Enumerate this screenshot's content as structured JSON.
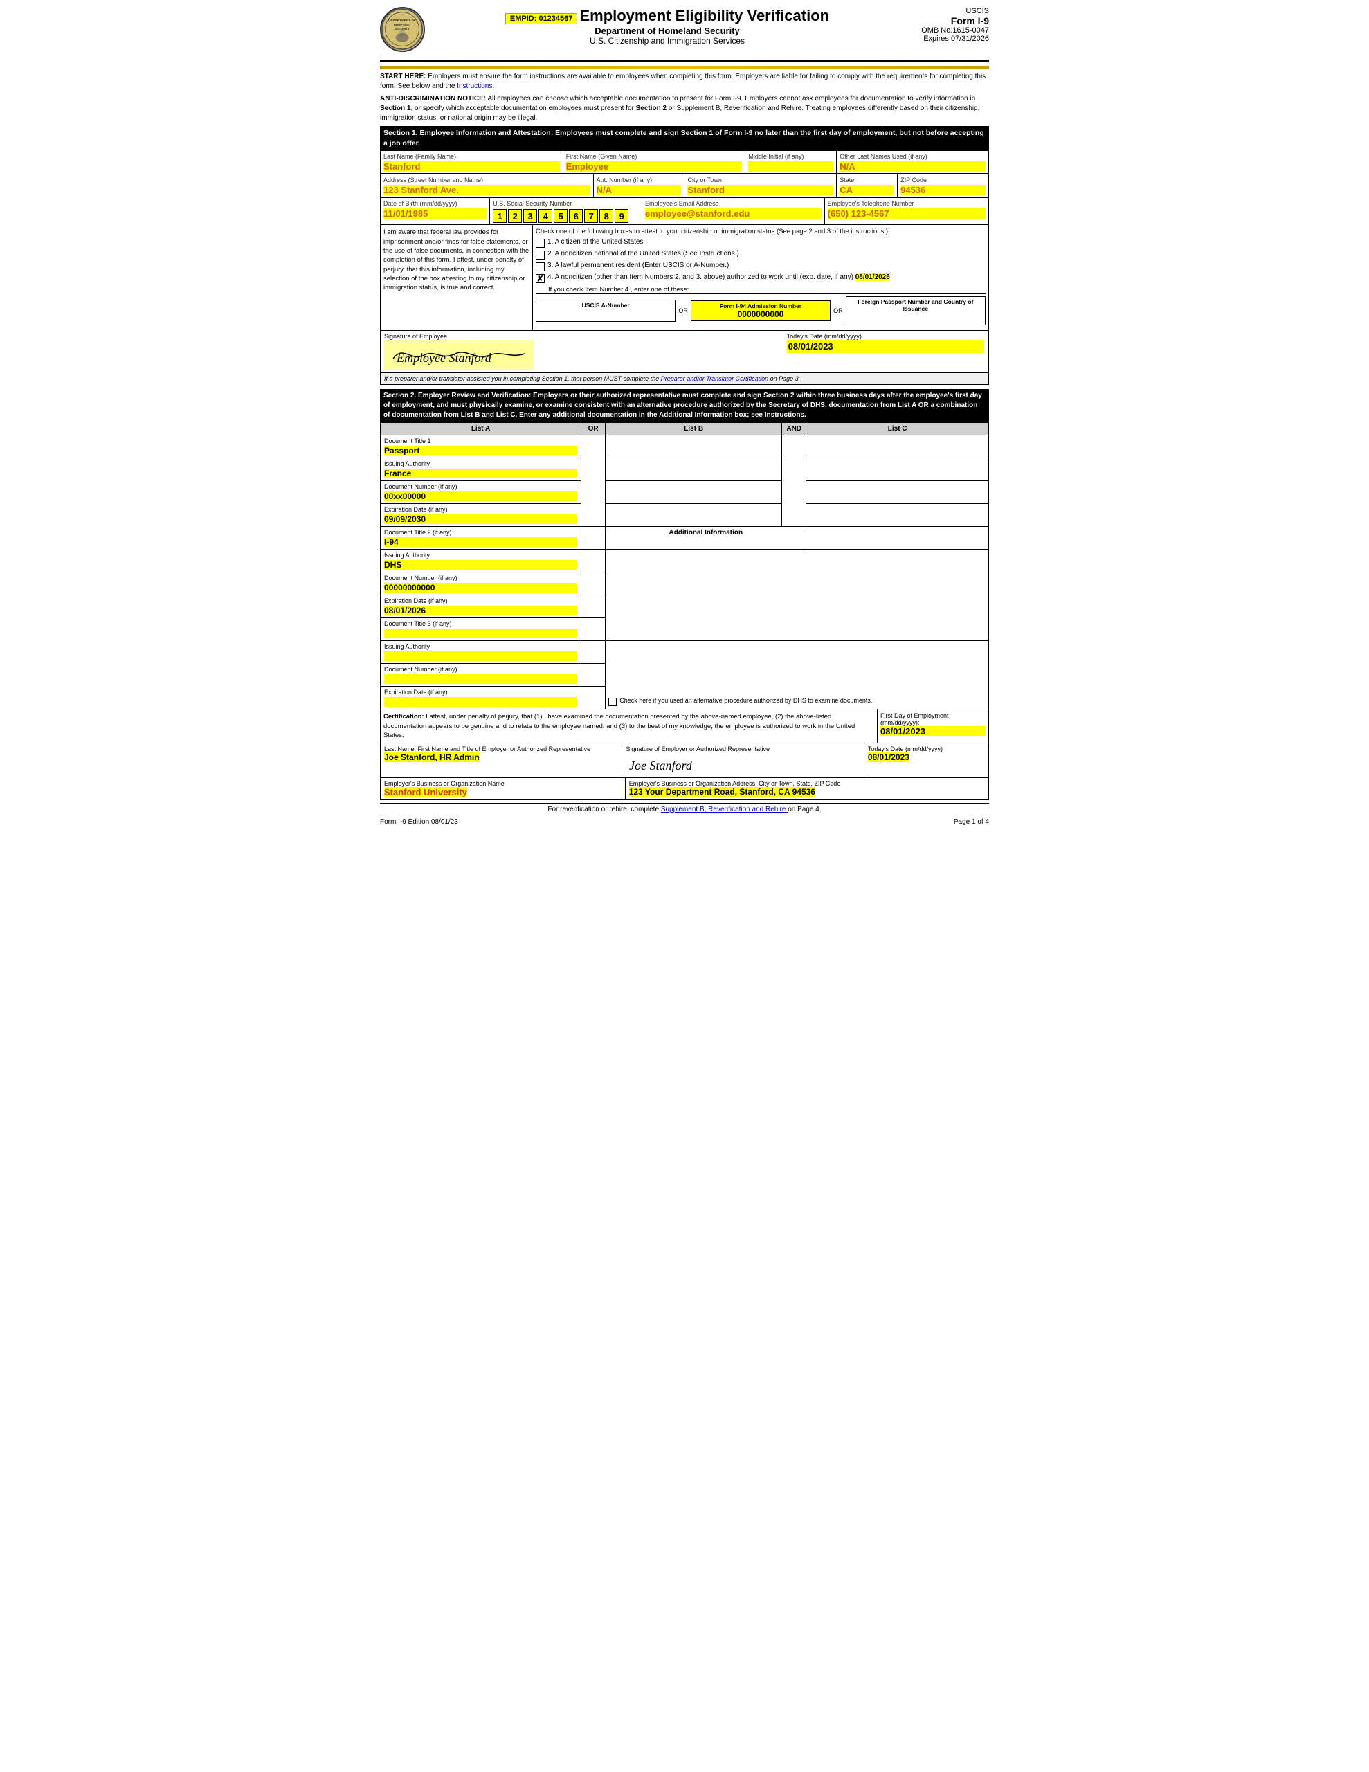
{
  "header": {
    "empid_label": "EMPID: 01234567",
    "form_title": "Employment Eligibility Verification",
    "dept": "Department of Homeland Security",
    "agency": "U.S. Citizenship and Immigration Services",
    "form_id": "USCIS",
    "form_name": "Form I-9",
    "omb": "OMB No.1615-0047",
    "expires": "Expires 07/31/2026"
  },
  "notices": {
    "start_here": "START HERE:  Employers must ensure the form instructions are available to employees when completing this form. Employers are liable for failing to comply with the requirements for completing this form. See below and the Instructions.",
    "anti_disc": "ANTI-DISCRIMINATION NOTICE:  All employees can choose which acceptable documentation to present for Form I-9. Employers cannot ask employees for documentation to verify information in Section 1, or specify which acceptable documentation employees must present for Section 2 or Supplement B, Reverification and Rehire.  Treating employees differently based on their citizenship, immigration status, or national origin may be illegal."
  },
  "section1": {
    "header": "Section 1. Employee Information and Attestation: Employees must complete and sign Section 1 of Form I-9 no later than the first day of employment, but not before accepting a job offer.",
    "last_name_label": "Last Name (Family Name)",
    "last_name": "Stanford",
    "first_name_label": "First Name (Given Name)",
    "first_name": "Employee",
    "middle_initial_label": "Middle Initial (if any)",
    "middle_initial": "",
    "other_names_label": "Other Last Names Used (if any)",
    "other_names": "N/A",
    "address_label": "Address (Street Number and Name)",
    "address": "123 Stanford Ave.",
    "apt_label": "Apt. Number (if any)",
    "apt": "N/A",
    "city_label": "City or Town",
    "city": "Stanford",
    "state_label": "State",
    "state": "CA",
    "zip_label": "ZIP Code",
    "zip": "94536",
    "dob_label": "Date of Birth (mm/dd/yyyy)",
    "dob": "11/01/1985",
    "ssn_label": "U.S. Social Security Number",
    "ssn_digits": [
      "1",
      "2",
      "3",
      "4",
      "5",
      "6",
      "7",
      "8",
      "9"
    ],
    "email_label": "Employee's Email Address",
    "email": "employee@stanford.edu",
    "phone_label": "Employee's Telephone Number",
    "phone": "(650) 123-4567",
    "attestation_left": "I am aware that federal law provides for imprisonment and/or fines for false statements, or the use of false documents, in connection with the completion of this form. I attest, under penalty of perjury, that this information, including my selection of the box attesting to my citizenship or immigration status, is true and correct.",
    "checkbox1": "1.  A citizen of the United States",
    "checkbox2": "2.  A noncitizen national of the United States (See Instructions.)",
    "checkbox3": "3.  A lawful permanent resident (Enter USCIS or A-Number.)",
    "checkbox4": "4.  A noncitizen (other than Item Numbers 2. and 3. above) authorized to work until (exp. date, if any)",
    "work_until": "08/01/2026",
    "if_check4": "If you check Item Number 4., enter one of these:",
    "uscis_label": "USCIS A-Number",
    "or1": "OR",
    "form94_label": "Form I-94 Admission Number",
    "form94_value": "0000000000",
    "or2": "OR",
    "passport_label": "Foreign Passport Number and Country of Issuance",
    "sig_label": "Signature of Employee",
    "sig_value": "Employee Stanford",
    "date_label": "Today's Date (mm/dd/yyyy)",
    "sig_date": "08/01/2023",
    "preparer_note": "If a preparer and/or translator assisted you in completing Section 1, that person MUST complete the Preparer and/or Translator Certification on Page 3."
  },
  "section2": {
    "header": "Section 2. Employer Review and Verification: Employers or their authorized representative must complete and sign Section 2 within three business days after the employee's first day of employment, and must physically examine, or examine consistent with an alternative procedure authorized by the Secretary of DHS, documentation from List A OR a combination of documentation from List B and List C. Enter any additional documentation in the Additional Information box; see Instructions.",
    "list_a_header": "List A",
    "or_header": "OR",
    "list_b_header": "List B",
    "and_header": "AND",
    "list_c_header": "List C",
    "doc1_title_label": "Document Title 1",
    "doc1_title": "Passport",
    "doc1_issuing_label": "Issuing Authority",
    "doc1_issuing": "France",
    "doc1_number_label": "Document Number (if any)",
    "doc1_number": "00xx00000",
    "doc1_exp_label": "Expiration Date (if any)",
    "doc1_exp": "09/09/2030",
    "doc2_title_label": "Document Title 2 (if any)",
    "doc2_title": "I-94",
    "add_info_label": "Additional Information",
    "doc2_issuing_label": "Issuing Authority",
    "doc2_issuing": "DHS",
    "doc2_number_label": "Document Number (if any)",
    "doc2_number": "00000000000",
    "doc2_exp_label": "Expiration Date (if any)",
    "doc2_exp": "08/01/2026",
    "doc3_title_label": "Document Title 3 (if any)",
    "doc3_title": "",
    "doc3_issuing_label": "Issuing Authority",
    "doc3_issuing": "",
    "doc3_number_label": "Document Number (if any)",
    "doc3_number": "",
    "doc3_exp_label": "Expiration Date (if any)",
    "doc3_exp": "",
    "alt_procedure": "Check here if you used an alternative procedure authorized by DHS to examine documents.",
    "cert_text": "Certification: I attest, under penalty of perjury, that (1) I have examined the documentation presented by the above-named employee, (2) the above-listed documentation appears to be genuine and to relate to the employee named, and (3) to the best of my knowledge, the employee is authorized to work in the United States.",
    "first_day_label": "First Day of Employment (mm/dd/yyyy):",
    "first_day": "08/01/2023",
    "employer_name_label": "Last Name, First Name and Title of Employer or Authorized Representative",
    "employer_name": "Joe Stanford, HR Admin",
    "sig_label": "Signature of Employer or Authorized Representative",
    "sig_value": "Joe Stanford",
    "today_date_label": "Today's Date (mm/dd/yyyy)",
    "today_date": "08/01/2023",
    "org_name_label": "Employer's Business or Organization Name",
    "org_name": "Stanford University",
    "org_address_label": "Employer's Business or Organization Address, City or Town, State, ZIP Code",
    "org_address": "123 Your Department Road, Stanford, CA 94536"
  },
  "footer": {
    "reverif_text": "For reverification or rehire, complete",
    "reverif_link": "Supplement B, Reverification and Rehire",
    "reverif_end": "on Page 4.",
    "edition": "Form I-9  Edition  08/01/23",
    "page": "Page 1 of 4"
  }
}
